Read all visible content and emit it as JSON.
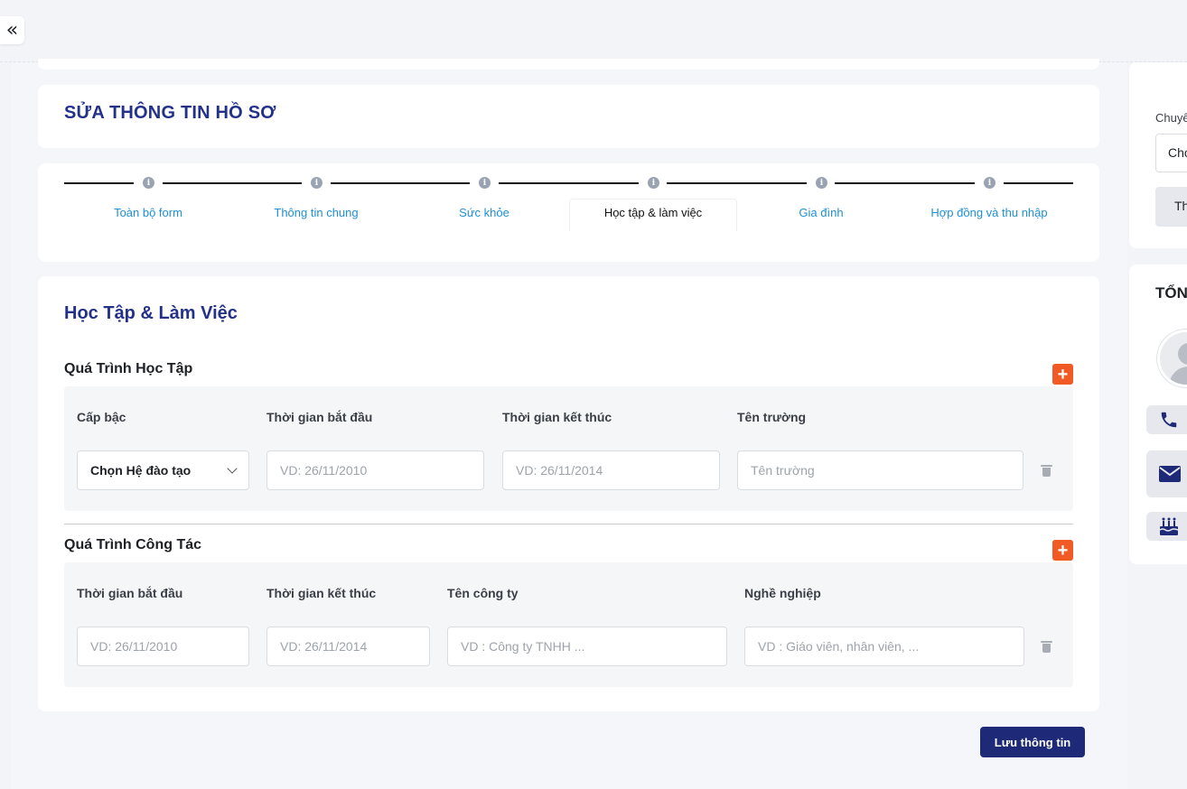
{
  "page_title": "SỬA THÔNG TIN HỒ SƠ",
  "steps": [
    {
      "label": "Toàn bộ form",
      "active": false
    },
    {
      "label": "Thông tin chung",
      "active": false
    },
    {
      "label": "Sức khỏe",
      "active": false
    },
    {
      "label": "Học tập & làm việc",
      "active": true
    },
    {
      "label": "Gia đình",
      "active": false
    },
    {
      "label": "Hợp đồng và thu nhập",
      "active": false
    }
  ],
  "step_icon": "i",
  "section_title": "Học Tập & Làm Việc",
  "education": {
    "title": "Quá Trình Học Tập",
    "add_label": "+",
    "columns": [
      "Cấp bậc",
      "Thời gian bắt đầu",
      "Thời gian kết thúc",
      "Tên trường"
    ],
    "level_select": "Chọn Hệ đào tạo",
    "start_placeholder": "VD: 26/11/2010",
    "end_placeholder": "VD: 26/11/2014",
    "school_placeholder": "Tên trường"
  },
  "work": {
    "title": "Quá Trình Công Tác",
    "add_label": "+",
    "columns": [
      "Thời gian bắt đầu",
      "Thời gian kết thúc",
      "Tên công ty",
      "Nghề nghiệp"
    ],
    "start_placeholder": "VD: 26/11/2010",
    "end_placeholder": "VD: 26/11/2014",
    "company_placeholder": "VD : Công ty TNHH ...",
    "job_placeholder": "VD : Giáo viên, nhân viên, ..."
  },
  "save_label": "Lưu thông tin",
  "collapse_label": "«",
  "right_panel": {
    "label": "Chuyể",
    "select": "Chọ",
    "button": "Th",
    "summary_title": "TỔN",
    "icons": [
      "phone-icon",
      "mail-icon",
      "birthday-cake-icon"
    ]
  },
  "colors": {
    "accent": "#23318a",
    "link": "#1f8fd6",
    "add": "#f15a24",
    "save": "#1e2a78"
  }
}
